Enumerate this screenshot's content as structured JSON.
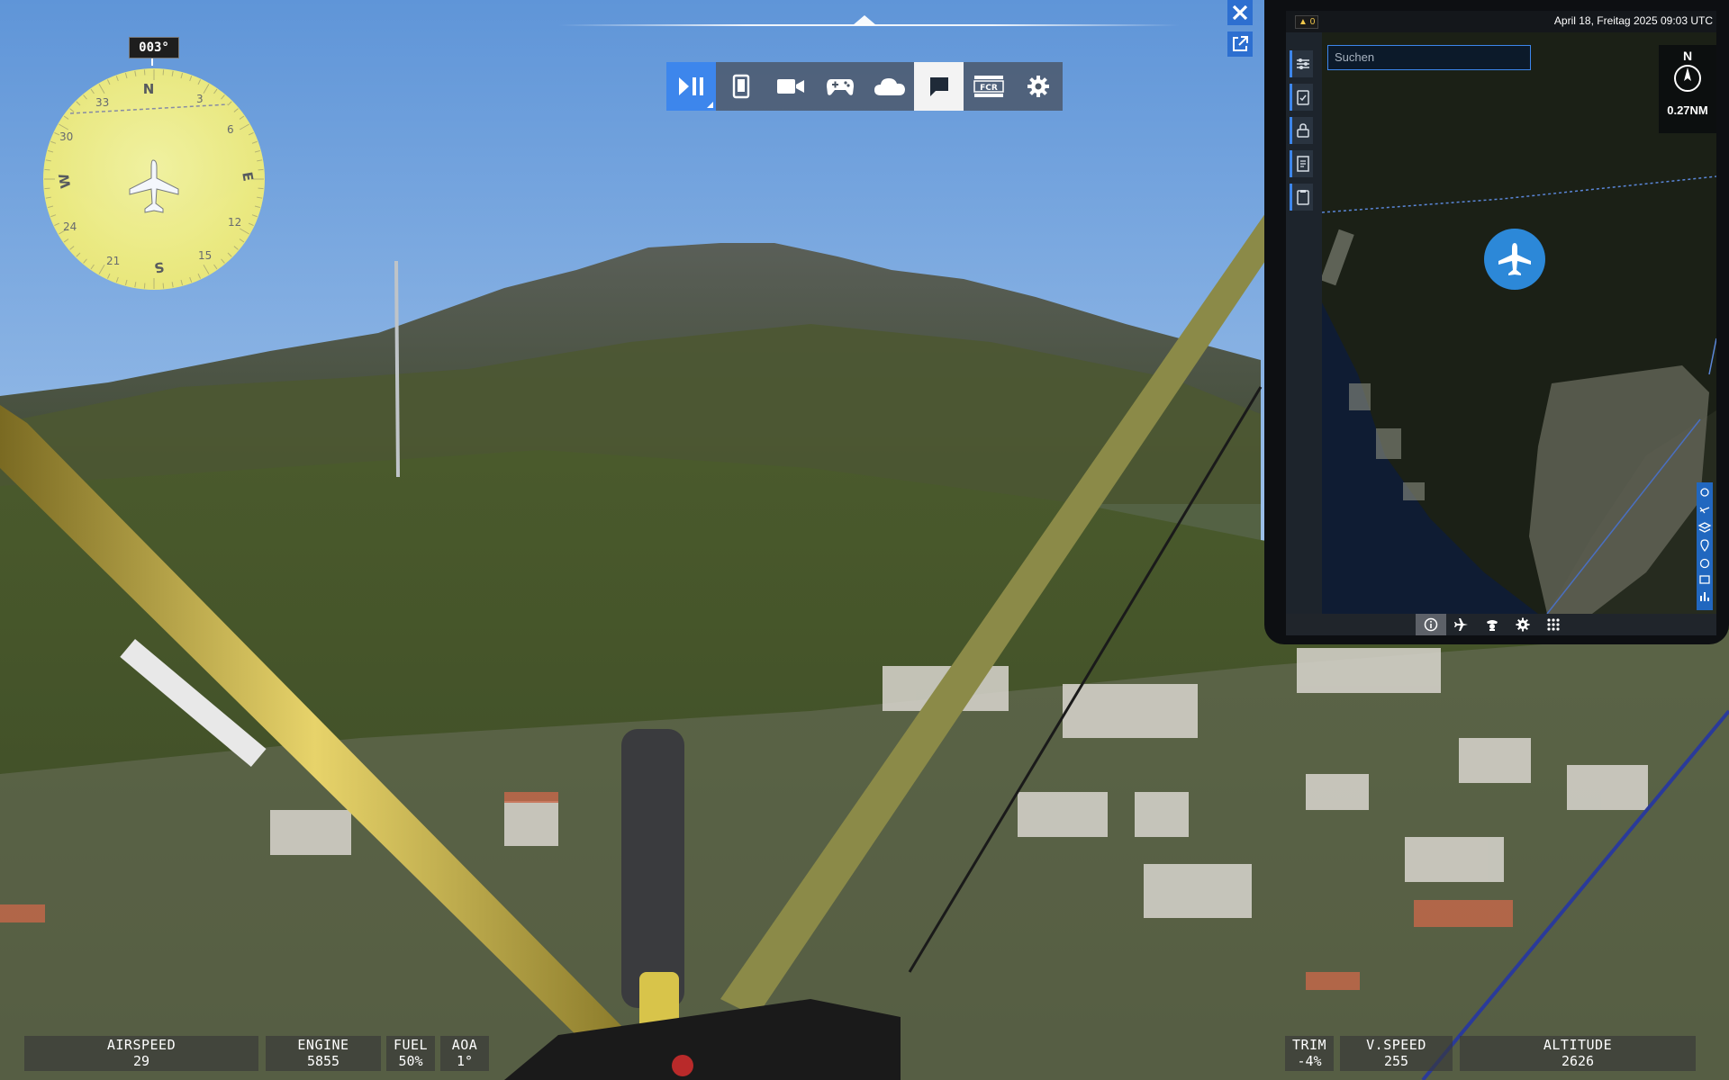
{
  "heading": {
    "value": "003°"
  },
  "compass": {
    "cardinals": [
      "N",
      "E",
      "S",
      "W"
    ],
    "numbers": [
      "3",
      "6",
      "12",
      "15",
      "21",
      "24",
      "30",
      "33"
    ]
  },
  "toolbar": {
    "items": [
      {
        "name": "play-pause-icon",
        "state": "active"
      },
      {
        "name": "tablet-icon",
        "state": "normal"
      },
      {
        "name": "camera-icon",
        "state": "normal"
      },
      {
        "name": "controller-icon",
        "state": "normal"
      },
      {
        "name": "weather-cloud-icon",
        "state": "normal"
      },
      {
        "name": "chat-icon",
        "state": "selected"
      },
      {
        "name": "fcr-icon",
        "state": "normal",
        "label": "FCR"
      },
      {
        "name": "settings-gear-icon",
        "state": "normal"
      }
    ]
  },
  "hud": {
    "airspeed": {
      "label": "AIRSPEED",
      "value": "29"
    },
    "engine": {
      "label": "ENGINE",
      "value": "5855"
    },
    "fuel": {
      "label": "FUEL",
      "value": "50%"
    },
    "aoa": {
      "label": "AOA",
      "value": "1°"
    },
    "trim": {
      "label": "TRIM",
      "value": "-4%"
    },
    "vspeed": {
      "label": "V.SPEED",
      "value": "255"
    },
    "altitude": {
      "label": "ALTITUDE",
      "value": "2626"
    }
  },
  "efb": {
    "notification_count": "0",
    "datetime": "April 18, Freitag 2025 09:03 UTC",
    "search_placeholder": "Suchen",
    "north_label": "N",
    "scale_label": "0.27NM",
    "colors": {
      "accent": "#3d86ec",
      "plane_marker": "#2c88d8",
      "background": "#1a1e24"
    }
  }
}
